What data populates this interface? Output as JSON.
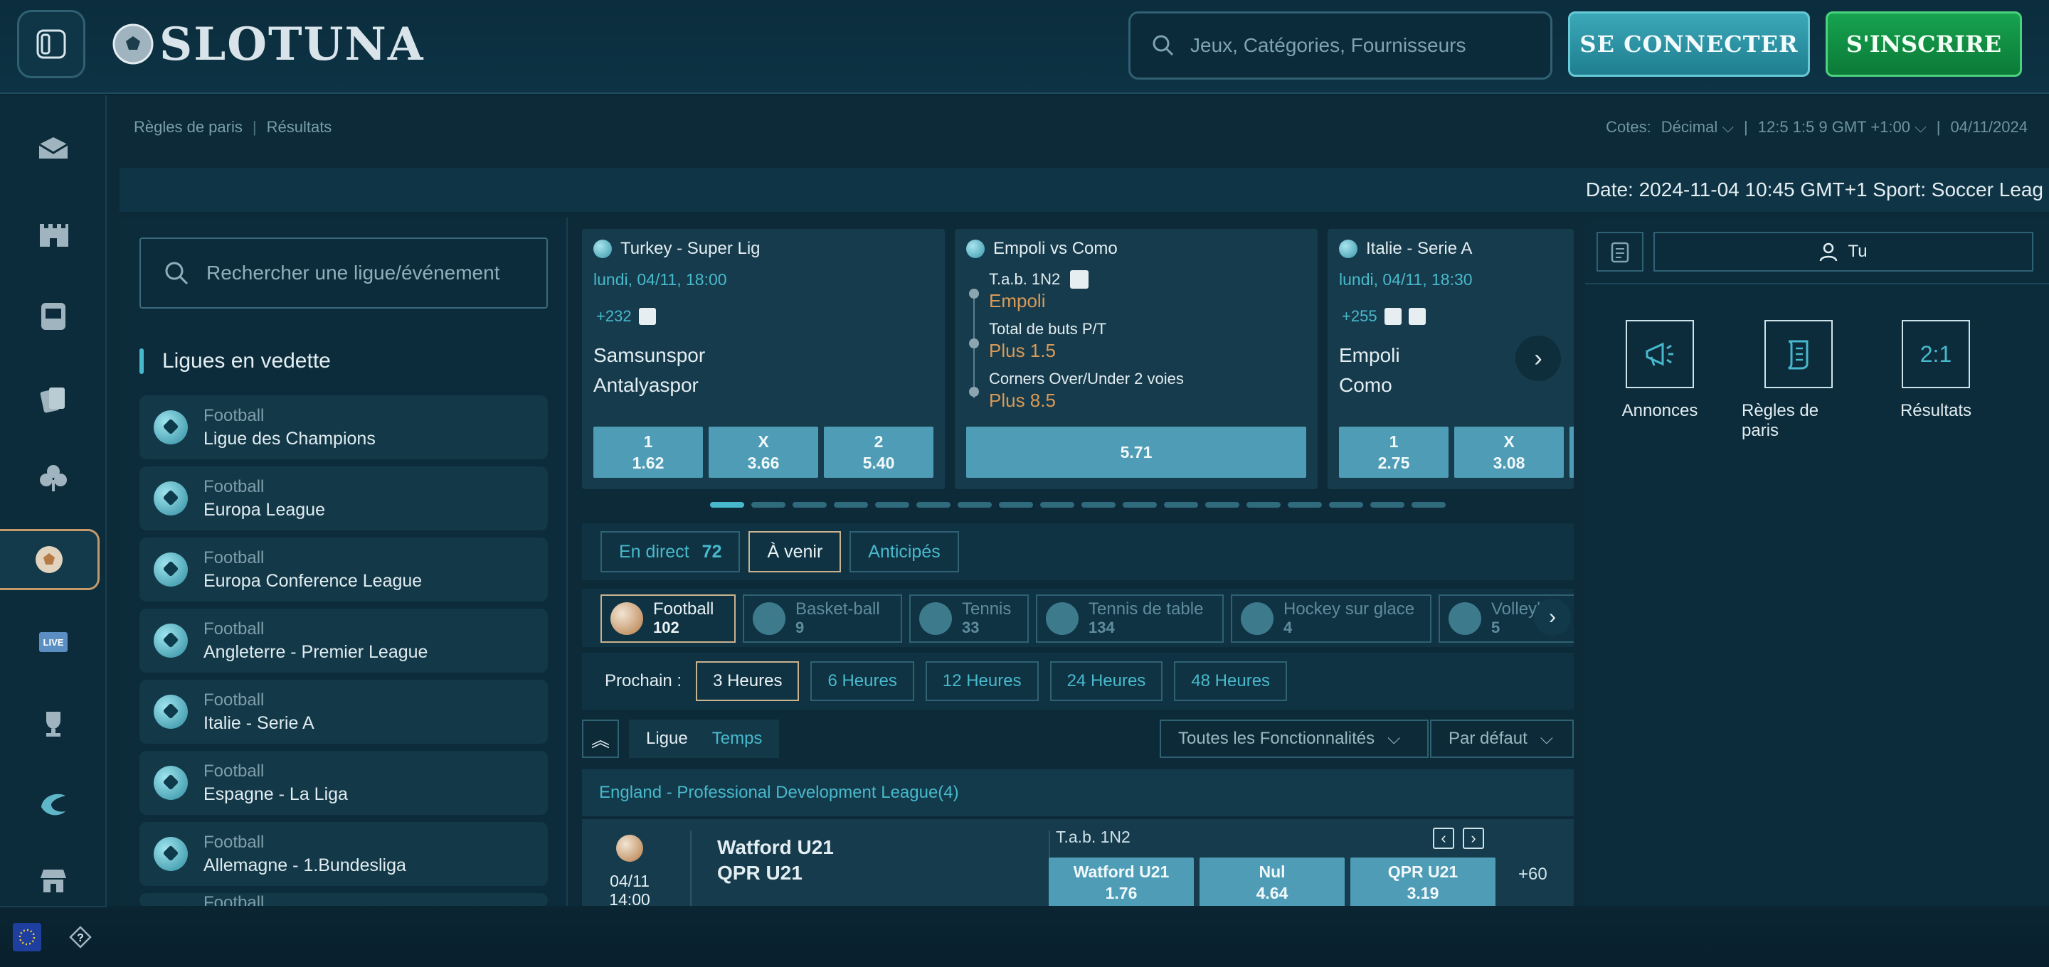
{
  "header": {
    "logo_text": "SLOTUNA",
    "search_placeholder": "Jeux, Catégories, Fournisseurs",
    "login_label": "SE CONNECTER",
    "register_label": "S'INSCRIRE"
  },
  "nav": {
    "icons": [
      "promotions-icon",
      "castle-icon",
      "slot-machine-icon",
      "cards-icon",
      "clover-icon",
      "sports-icon",
      "live-icon",
      "trophy-icon",
      "dragon-icon",
      "shop-icon"
    ],
    "live_label": "LIVE"
  },
  "breadcrumb": {
    "rules": "Règles de paris",
    "results": "Résultats"
  },
  "topinfo": {
    "odds_label": "Cotes:",
    "odds_value": "Décimal",
    "time": "12:5 1:5 9 GMT +1:00",
    "date": "04/11/2024"
  },
  "ticker": {
    "text": "Date: 2024-11-04 10:45 GMT+1 Sport: Soccer Leag"
  },
  "leagues": {
    "search_placeholder": "Rechercher une ligue/événement",
    "featured_title": "Ligues en vedette",
    "items": [
      {
        "sport": "Football",
        "name": "Ligue des Champions"
      },
      {
        "sport": "Football",
        "name": "Europa League"
      },
      {
        "sport": "Football",
        "name": "Europa Conference League"
      },
      {
        "sport": "Football",
        "name": "Angleterre - Premier League"
      },
      {
        "sport": "Football",
        "name": "Italie - Serie A"
      },
      {
        "sport": "Football",
        "name": "Espagne - La Liga"
      },
      {
        "sport": "Football",
        "name": "Allemagne - 1.Bundesliga"
      },
      {
        "sport": "Football",
        "name": ""
      }
    ]
  },
  "cards": [
    {
      "league": "Turkey - Super Lig",
      "date": "lundi, 04/11, 18:00",
      "more": "+232",
      "home": "Samsunspor",
      "away": "Antalyaspor",
      "odds": [
        {
          "label": "1",
          "value": "1.62"
        },
        {
          "label": "X",
          "value": "3.66"
        },
        {
          "label": "2",
          "value": "5.40"
        }
      ]
    },
    {
      "league": "Empoli vs Como",
      "markets": [
        {
          "name": "T.a.b. 1N2",
          "value": "Empoli"
        },
        {
          "name": "Total de buts P/T",
          "value": "Plus 1.5"
        },
        {
          "name": "Corners Over/Under 2 voies",
          "value": "Plus 8.5"
        }
      ],
      "combo_odds": "5.71"
    },
    {
      "league": "Italie - Serie A",
      "date": "lundi, 04/11, 18:30",
      "more": "+255",
      "home": "Empoli",
      "away": "Como",
      "odds": [
        {
          "label": "1",
          "value": "2.75"
        },
        {
          "label": "X",
          "value": "3.08"
        }
      ]
    }
  ],
  "tabs": {
    "live": "En direct",
    "live_count": "72",
    "upcoming": "À venir",
    "early": "Anticipés"
  },
  "sports": [
    {
      "name": "Football",
      "count": "102"
    },
    {
      "name": "Basket-ball",
      "count": "9"
    },
    {
      "name": "Tennis",
      "count": "33"
    },
    {
      "name": "Tennis de table",
      "count": "134"
    },
    {
      "name": "Hockey sur glace",
      "count": "4"
    },
    {
      "name": "Volleyball",
      "count": "5"
    }
  ],
  "next": {
    "label": "Prochain :",
    "options": [
      "3 Heures",
      "6 Heures",
      "12 Heures",
      "24 Heures",
      "48 Heures"
    ]
  },
  "sort": {
    "league": "Ligue",
    "time": "Temps",
    "features": "Toutes les Fonctionnalités",
    "default": "Par défaut"
  },
  "league_header": "England - Professional Development League(4)",
  "match": {
    "date": "04/11",
    "time": "14:00",
    "home": "Watford U21",
    "away": "QPR U21",
    "market": "T.a.b. 1N2",
    "odds": [
      {
        "label": "Watford U21",
        "value": "1.76"
      },
      {
        "label": "Nul",
        "value": "4.64"
      },
      {
        "label": "QPR U21",
        "value": "3.19"
      }
    ],
    "more": "+60"
  },
  "rightpanel": {
    "tab_label": "Tu",
    "items": [
      {
        "label": "Annonces"
      },
      {
        "label": "Règles de paris"
      },
      {
        "label": "Résultats"
      }
    ],
    "results_icon_text": "2:1"
  },
  "colors": {
    "accent": "#48b9cc",
    "login": "#2a95a6",
    "register": "#13964a",
    "odds_bg": "#4f9cb6",
    "selected_border": "#c9b28f"
  }
}
